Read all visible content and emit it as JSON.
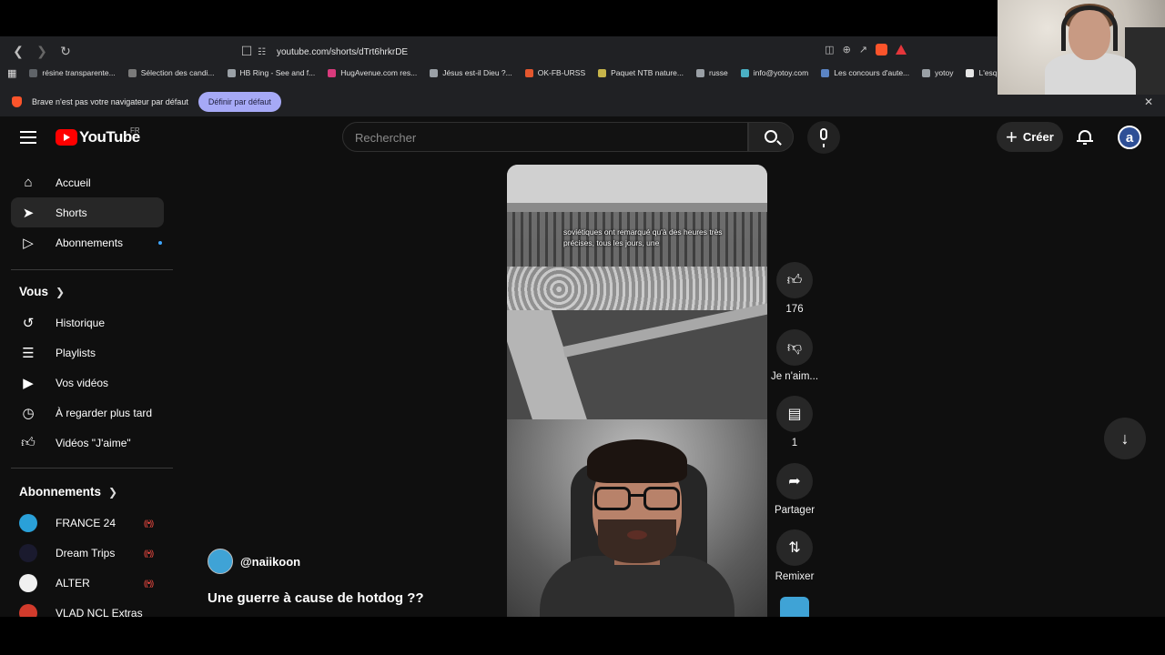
{
  "browser": {
    "url": "youtube.com/shorts/dTrt6hrkrDE",
    "bookmarks": [
      {
        "label": "résine transparente...",
        "color": "#5f6368"
      },
      {
        "label": "Sélection des candi...",
        "color": "#7a7a7a"
      },
      {
        "label": "HB Ring - See and f...",
        "color": "#9aa0a6"
      },
      {
        "label": "HugAvenue.com res...",
        "color": "#d93a7c"
      },
      {
        "label": "Jésus est-il Dieu ?...",
        "color": "#9aa0a6"
      },
      {
        "label": "OK-FB-URSS",
        "color": "#e4572e"
      },
      {
        "label": "Paquet NTB nature...",
        "color": "#c7b44a"
      },
      {
        "label": "russe",
        "color": "#9aa0a6"
      },
      {
        "label": "info@yotoy.com",
        "color": "#4ab0c4"
      },
      {
        "label": "Les concours d'aute...",
        "color": "#5b84c4"
      },
      {
        "label": "yotoy",
        "color": "#9aa0a6"
      },
      {
        "label": "L'esquif fantôme eB...",
        "color": "#e6e6e6"
      }
    ],
    "infobar": {
      "message": "Brave n'est pas votre navigateur par défaut",
      "button": "Définir par défaut"
    }
  },
  "youtube": {
    "logo_text": "YouTube",
    "region": "FR",
    "search_placeholder": "Rechercher",
    "create_label": "Créer",
    "avatar_letter": "a"
  },
  "sidebar": {
    "main": [
      {
        "label": "Accueil",
        "icon": "home-icon"
      },
      {
        "label": "Shorts",
        "icon": "shorts-icon",
        "active": true
      },
      {
        "label": "Abonnements",
        "icon": "subscriptions-icon"
      }
    ],
    "you_heading": "Vous",
    "you_items": [
      {
        "label": "Historique",
        "icon": "history-icon"
      },
      {
        "label": "Playlists",
        "icon": "playlists-icon"
      },
      {
        "label": "Vos vidéos",
        "icon": "your-videos-icon"
      },
      {
        "label": "À regarder plus tard",
        "icon": "watch-later-icon"
      },
      {
        "label": "Vidéos \"J'aime\"",
        "icon": "liked-videos-icon"
      }
    ],
    "subs_heading": "Abonnements",
    "subscriptions": [
      {
        "label": "FRANCE 24",
        "color": "#2aa0d8"
      },
      {
        "label": "Dream Trips",
        "color": "#1a1a2e"
      },
      {
        "label": "ALTER",
        "color": "#f0f0f0"
      },
      {
        "label": "VLAD NCL Extras",
        "color": "#d23b2c"
      }
    ]
  },
  "short": {
    "caption": "soviétiques ont remarqué qu'à des heures très précises, tous les jours, une",
    "channel": "@naiikoon",
    "title": "Une guerre à cause de hotdog ??",
    "actions": {
      "likes": "176",
      "dislike_label": "Je n'aim...",
      "comments": "1",
      "share_label": "Partager",
      "remix_label": "Remixer"
    }
  }
}
